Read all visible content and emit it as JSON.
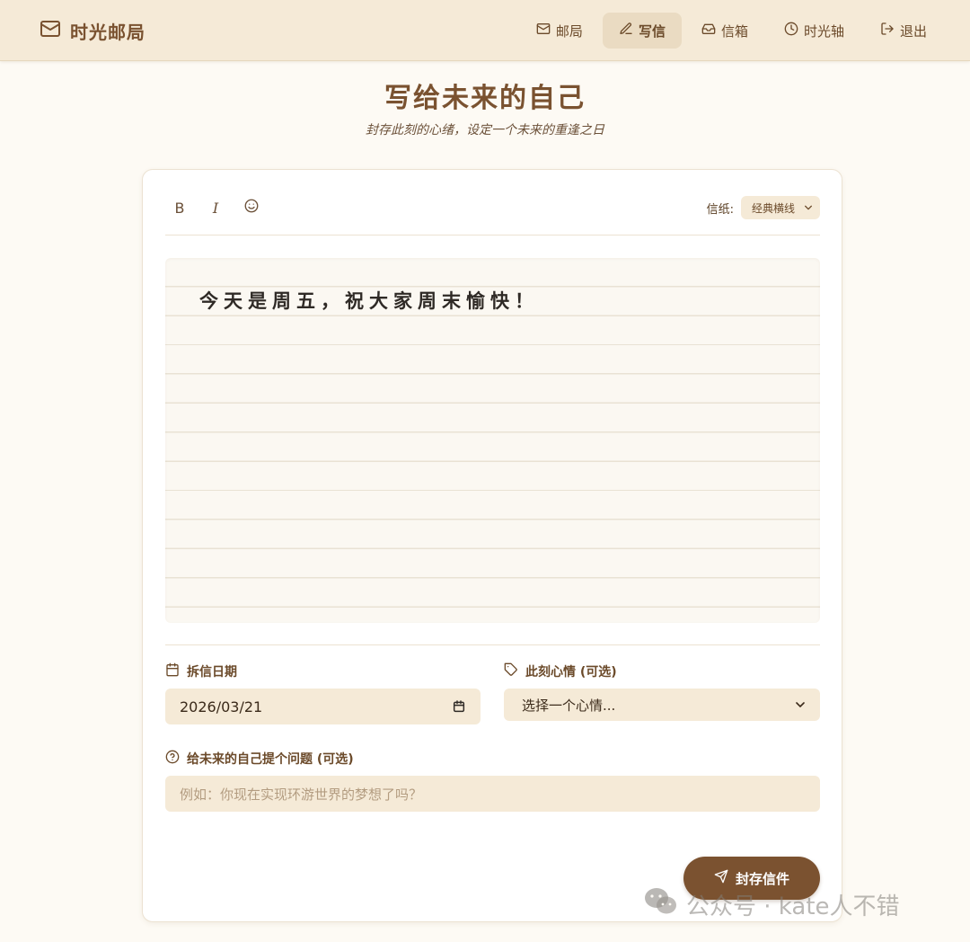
{
  "brand": {
    "name": "时光邮局",
    "icon": "mail-icon"
  },
  "nav": [
    {
      "label": "邮局",
      "icon": "mail-icon",
      "active": false
    },
    {
      "label": "写信",
      "icon": "pen-icon",
      "active": true
    },
    {
      "label": "信箱",
      "icon": "inbox-icon",
      "active": false
    },
    {
      "label": "时光轴",
      "icon": "clock-icon",
      "active": false
    },
    {
      "label": "退出",
      "icon": "logout-icon",
      "active": false
    }
  ],
  "page": {
    "title": "写给未来的自己",
    "subtitle": "封存此刻的心绪，设定一个未来的重逢之日"
  },
  "editor": {
    "bold_label": "B",
    "italic_label": "I",
    "emoji_icon": "smile-icon",
    "paper_label": "信纸:",
    "paper_value": "经典横线",
    "content": "今天是周五，祝大家周末愉快！"
  },
  "form": {
    "open_date": {
      "label": "拆信日期",
      "value": "2026/03/21",
      "icon": "calendar-icon"
    },
    "mood": {
      "label": "此刻心情 (可选)",
      "value": "选择一个心情...",
      "icon": "tag-icon"
    },
    "question": {
      "label": "给未来的自己提个问题 (可选)",
      "placeholder": "例如：你现在实现环游世界的梦想了吗？",
      "icon": "help-circle-icon"
    }
  },
  "submit_label": "封存信件",
  "watermark": "公众号 · kate人不错",
  "colors": {
    "accent": "#7b5230",
    "header_bg": "#f5ead7",
    "input_bg": "#f5ead7",
    "page_bg": "#fdfaf4"
  }
}
